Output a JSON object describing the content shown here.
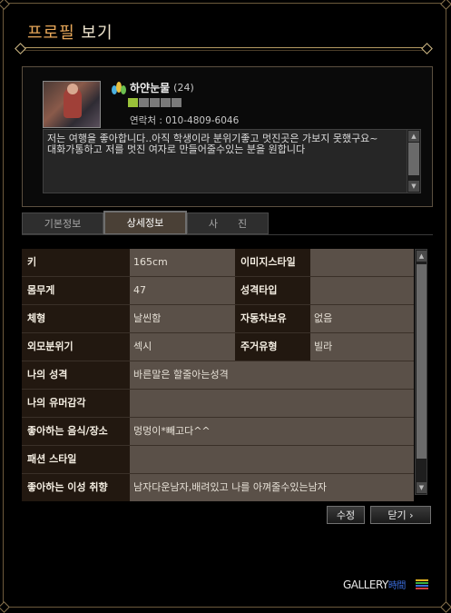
{
  "dialog": {
    "title_accent": "프로필",
    "title_rest": " 보기"
  },
  "profile": {
    "name": "하얀눈물",
    "age": "(24)",
    "contact": "연락처 : 010-4809-6046",
    "intro_line1": "저는 여행을 좋아합니다..아직 학생이라 분위기좋고 멋진곳은 가보지 못했구요~",
    "intro_line2": "대화가통하고 저를 멋진 여자로 만들어줄수있는 분을 원합니다",
    "level_colors": [
      "#9ac23a",
      "#7a7a7a",
      "#7a7a7a",
      "#7a7a7a",
      "#7a7a7a"
    ]
  },
  "tabs": [
    {
      "label": "기본정보",
      "active": false
    },
    {
      "label": "상세정보",
      "active": true
    },
    {
      "label": "사　　진",
      "active": false
    }
  ],
  "details": {
    "height_label": "키",
    "height_value": "165cm",
    "image_style_label": "이미지스타일",
    "image_style_value": "",
    "weight_label": "몸무게",
    "weight_value": "47",
    "personality_type_label": "성격타입",
    "personality_type_value": "",
    "body_type_label": "체형",
    "body_type_value": "날씬함",
    "car_label": "자동차보유",
    "car_value": "없음",
    "look_label": "외모분위기",
    "look_value": "섹시",
    "residence_label": "주거유형",
    "residence_value": "빌라",
    "my_personality_label": "나의 성격",
    "my_personality_value": "바른말은 할줄아는성격",
    "humor_label": "나의 유머감각",
    "humor_value": "",
    "food_label": "좋아하는 음식/장소",
    "food_value": "멍멍이*빼고다^^",
    "fashion_label": "패션 스타일",
    "fashion_value": "",
    "ideal_label": "좋아하는 이성 취향",
    "ideal_value": "남자다운남자,배려있고 나를 아껴줄수있는남자"
  },
  "buttons": {
    "edit_label": "수정",
    "close_label": "닫기 ›"
  },
  "brand": {
    "name": "GALLERY",
    "name_suffix": "時間",
    "bar_colors": [
      "#e0b020",
      "#3ab040",
      "#3a6bd8",
      "#d04040"
    ]
  }
}
